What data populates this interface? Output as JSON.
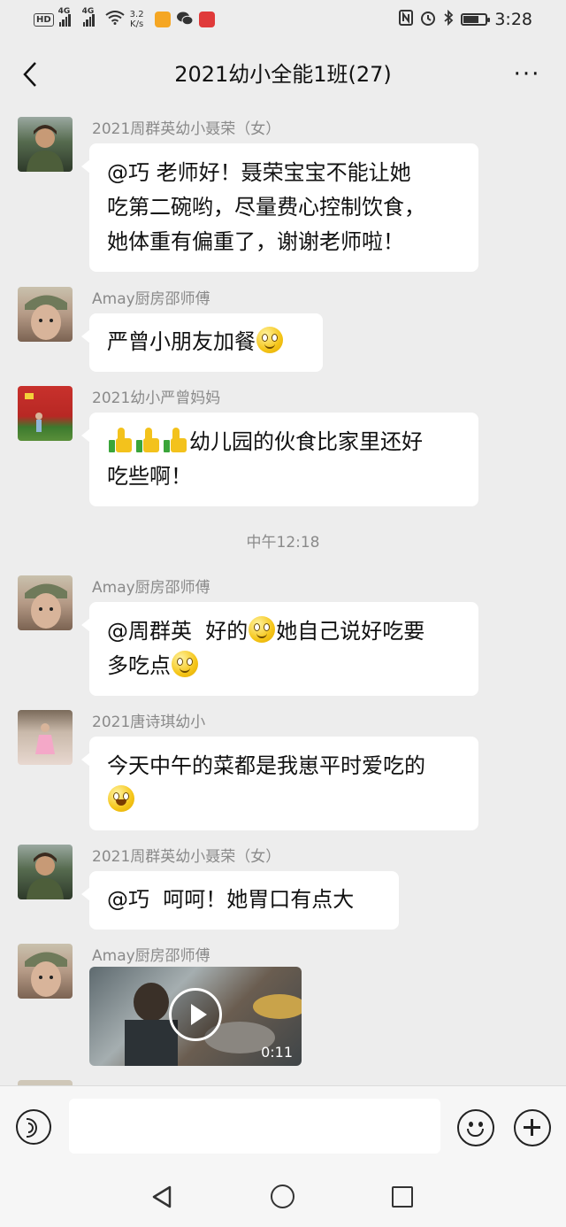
{
  "status_bar": {
    "hd_badge": "HD",
    "network_1": "4G",
    "network_2": "4G",
    "speed_value": "3.2",
    "speed_unit": "K/s",
    "time": "3:28",
    "battery_level": 0.7
  },
  "header": {
    "title": "2021幼小全能1班(27)",
    "more_label": "···"
  },
  "messages": [
    {
      "sender": "2021周群英幼小聂荣（女）",
      "lines": [
        "@巧  老师好！聂荣宝宝不能让她",
        "吃第二碗哟，尽量费心控制饮食，",
        "她体重有偏重了，谢谢老师啦！"
      ]
    },
    {
      "sender": "Amay厨房邵师傅",
      "text": "严曾小朋友加餐",
      "emoji": "smile"
    },
    {
      "sender": "2021幼小严曾妈妈",
      "line1_suffix": "幼儿园的伙食比家里还好",
      "line2": "吃些啊！",
      "emoji": "thumbs-up"
    },
    {
      "time_divider": "中午12:18"
    },
    {
      "sender": "Amay厨房邵师傅",
      "line1_a": "@周群英  好的",
      "line1_b": "她自己说好吃要",
      "line2": "多吃点",
      "emoji": "smile"
    },
    {
      "sender": "2021唐诗琪幼小",
      "line1": "今天中午的菜都是我崽平时爱吃的",
      "emoji": "grin"
    },
    {
      "sender": "2021周群英幼小聂荣（女）",
      "text": "@巧  呵呵！她胃口有点大"
    },
    {
      "sender": "Amay厨房邵师傅",
      "video_duration": "0:11"
    }
  ],
  "input_bar": {
    "placeholder": "",
    "voice_icon": "voice-icon",
    "emoji_icon": "emoji-icon",
    "plus_icon": "plus-icon"
  },
  "nav_bar": {
    "back_icon": "triangle-back-icon",
    "home_icon": "circle-home-icon",
    "recent_icon": "square-recent-icon"
  }
}
